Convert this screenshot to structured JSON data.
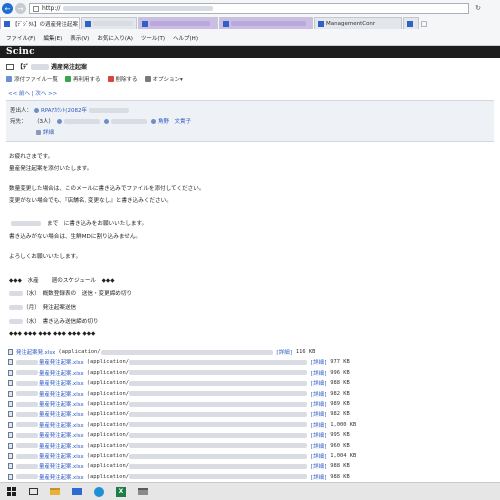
{
  "browser": {
    "back_icon": "back-arrow-icon",
    "forward_icon": "forward-arrow-icon",
    "url": "http://",
    "refresh_icon": "refresh-icon",
    "tabs": [
      {
        "label": "【ﾃﾞｼﾞﾀﾙ】の週産発注起案",
        "active": true
      },
      {
        "label": "",
        "active": false
      },
      {
        "label": "",
        "active": false
      },
      {
        "label": "",
        "active": false
      },
      {
        "label": "ManagementConr",
        "active": false
      },
      {
        "label": "",
        "active": false
      }
    ],
    "menu": [
      "ファイル(F)",
      "編集(E)",
      "表示(V)",
      "お気に入り(A)",
      "ツール(T)",
      "ヘルプ(H)"
    ]
  },
  "app": {
    "logo": "Scinc"
  },
  "mail": {
    "title": "【ﾃﾞ",
    "title_suffix": "週産発注起案",
    "toolbar": [
      {
        "label": "添付ファイル一覧",
        "icon": "attachment-list-icon",
        "color": "#6b8fd4"
      },
      {
        "label": "再利用する",
        "icon": "reuse-icon",
        "color": "#3aa64b"
      },
      {
        "label": "削除する",
        "icon": "delete-icon",
        "color": "#d9453a"
      },
      {
        "label": "オプション▾",
        "icon": "options-icon",
        "color": "#7a7a7a"
      }
    ],
    "prev_next": "<< 前へ | 次へ >>",
    "sender_label": "差出人：",
    "sender_value": "RPAｱｶｳﾝﾄ(2082年",
    "recipients_label": "宛先：",
    "recipients_count": "（3人）",
    "recipient_named": "角野　文貴子",
    "details_link": "詳細"
  },
  "body": {
    "lines": [
      "お疲れさまです。",
      "量産発注起案を添付いたします。",
      "",
      "数量変更した場合は、このメールに書き込みでファイルを添付してください。",
      "変更がない場合でも、『店舗名, 変更なし』と書き込みください。",
      "",
      "まで　に書き込みをお願いいたします。",
      "書き込みがない場合は、生鮮MDに割り込みません。",
      "",
      "よろしくお願いいたします。",
      "",
      "◆◆◆　水産　　 週のスケジュール　◆◆◆",
      "（水）　概数登録表の　送信・変更締め切り",
      "（月）　発注起案送信",
      "（水）　書き込み送信締め切り",
      "◆◆◆ ◆◆◆ ◆◆◆ ◆◆◆ ◆◆◆ ◆◆◆"
    ]
  },
  "attachments": {
    "items": [
      {
        "name": "発注起案発.xlsx",
        "mime": "(application/",
        "detail": "[詳細]",
        "size": "116 KB"
      },
      {
        "name": "量産発注起案.xlsx",
        "mime": "(application/",
        "detail": "[詳細]",
        "size": "977 KB"
      },
      {
        "name": "量産発注起案.xlsx",
        "mime": "(application/",
        "detail": "[詳細]",
        "size": "996 KB"
      },
      {
        "name": "量産発注起案.xlsx",
        "mime": "(application/",
        "detail": "[詳細]",
        "size": "988 KB"
      },
      {
        "name": "量産発注起案.xlsx",
        "mime": "(application/",
        "detail": "[詳細]",
        "size": "982 KB"
      },
      {
        "name": "量産発注起案.xlsx",
        "mime": "(application/",
        "detail": "[詳細]",
        "size": "989 KB"
      },
      {
        "name": "量産発注起案.xlsx",
        "mime": "(application/",
        "detail": "[詳細]",
        "size": "982 KB"
      },
      {
        "name": "量産発注起案.xlsx",
        "mime": "(application/",
        "detail": "[詳細]",
        "size": "1,000 KB"
      },
      {
        "name": "量産発注起案.xlsx",
        "mime": "(application/",
        "detail": "[詳細]",
        "size": "995 KB"
      },
      {
        "name": "量産発注起案.xlsx",
        "mime": "(application/",
        "detail": "[詳細]",
        "size": "960 KB"
      },
      {
        "name": "量産発注起案.xlsx",
        "mime": "(application/",
        "detail": "[詳細]",
        "size": "1,004 KB"
      },
      {
        "name": "量産発注起案.xlsx",
        "mime": "(application/",
        "detail": "[詳細]",
        "size": "988 KB"
      },
      {
        "name": "量産発注起案.xlsx",
        "mime": "(application/",
        "detail": "[詳細]",
        "size": "988 KB"
      }
    ]
  },
  "taskbar": {
    "icons": [
      "windows-start-icon",
      "task-view-icon",
      "file-explorer-icon",
      "mail-app-icon",
      "edge-browser-icon",
      "excel-icon",
      "printer-icon"
    ]
  }
}
